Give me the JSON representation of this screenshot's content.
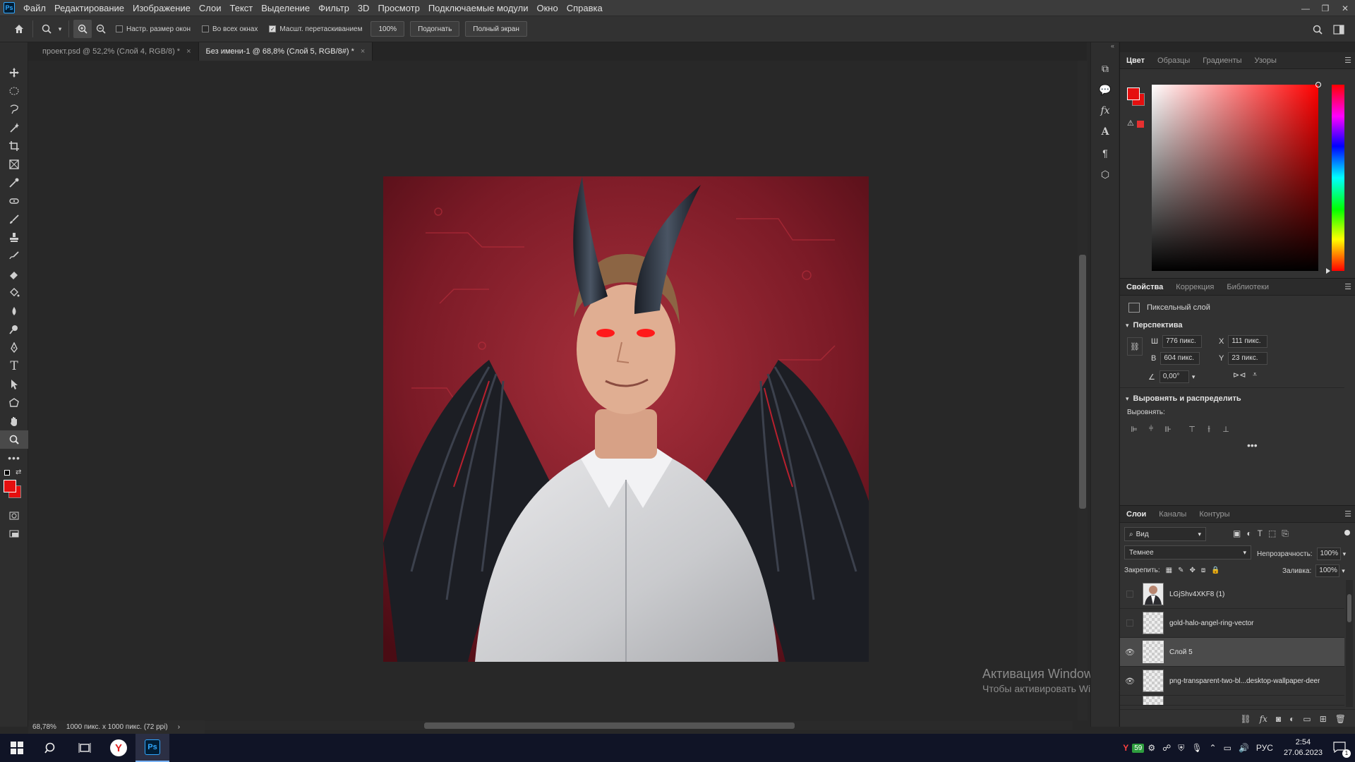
{
  "menubar": {
    "logo": "Ps",
    "items": [
      "Файл",
      "Редактирование",
      "Изображение",
      "Слои",
      "Текст",
      "Выделение",
      "Фильтр",
      "3D",
      "Просмотр",
      "Подключаемые модули",
      "Окно",
      "Справка"
    ]
  },
  "options": {
    "chk_resize": "Настр. размер окон",
    "chk_all_windows": "Во всех окнах",
    "chk_scrubby": "Масшт. перетаскиванием",
    "btn_100": "100%",
    "btn_fit": "Подогнать",
    "btn_fullscreen": "Полный экран"
  },
  "tabs": [
    {
      "label": "проект.psd @ 52,2% (Слой 4, RGB/8) *",
      "active": false
    },
    {
      "label": "Без имени-1 @ 68,8% (Слой 5, RGB/8#) *",
      "active": true
    }
  ],
  "status": {
    "zoom": "68,78%",
    "doc_info": "1000 пикс. x 1000 пикс. (72 ppi)"
  },
  "watermark": {
    "title": "Активация Windows",
    "subtitle": "Чтобы активировать Windows, перейдите в раздел \"Параметры\"."
  },
  "color_panel": {
    "tabs": [
      "Цвет",
      "Образцы",
      "Градиенты",
      "Узоры"
    ],
    "foreground": "#e50f0f"
  },
  "properties": {
    "tabs": [
      "Свойства",
      "Коррекция",
      "Библиотеки"
    ],
    "layer_type": "Пиксельный слой",
    "perspective_title": "Перспектива",
    "w_label": "Ш",
    "w_value": "776 пикс.",
    "h_label": "В",
    "h_value": "604 пикс.",
    "x_label": "X",
    "x_value": "111 пикс.",
    "y_label": "Y",
    "y_value": "23 пикс.",
    "angle_value": "0,00°",
    "align_title": "Выровнять и распределить",
    "align_label": "Выровнять:"
  },
  "layers": {
    "tabs": [
      "Слои",
      "Каналы",
      "Контуры"
    ],
    "filter_label": "Вид",
    "blend_mode": "Темнее",
    "opacity_label": "Непрозрачность:",
    "opacity_value": "100%",
    "lock_label": "Закрепить:",
    "fill_label": "Заливка:",
    "fill_value": "100%",
    "rows": [
      {
        "name": "LGjShv4XKF8 (1)",
        "visible": false,
        "selected": false
      },
      {
        "name": "gold-halo-angel-ring-vector",
        "visible": false,
        "selected": false
      },
      {
        "name": "Слой 5",
        "visible": true,
        "selected": true
      },
      {
        "name": "png-transparent-two-bl...desktop-wallpaper-deer",
        "visible": true,
        "selected": false
      }
    ]
  },
  "taskbar": {
    "lang": "РУС",
    "time": "2:54",
    "date": "27.06.2023",
    "badge": "59",
    "notif": "1"
  }
}
